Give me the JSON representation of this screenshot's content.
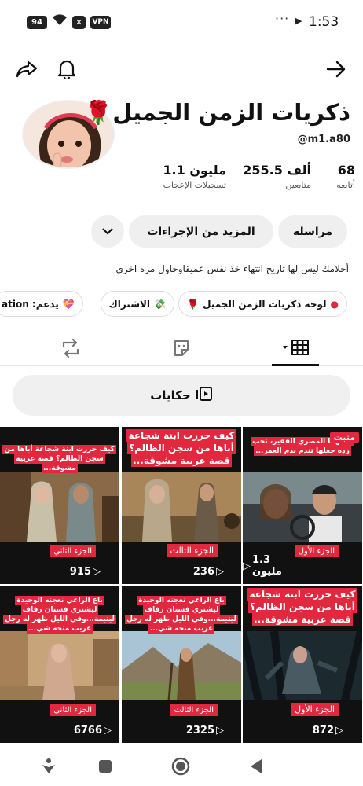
{
  "status_bar": {
    "battery": "94",
    "vpn": "VPN",
    "time": "1:53",
    "dots": "···"
  },
  "profile": {
    "name": "ذكريات الزمن الجميل",
    "name_emoji": "🌹",
    "handle": "@m1.a80",
    "stats": [
      {
        "value": "68",
        "label": "أتابعه"
      },
      {
        "value": "255.5 ألف",
        "label": "متابعين"
      },
      {
        "value": "1.1 مليون",
        "label": "تسجيلات الإعجاب"
      }
    ],
    "bio": "أحلامك ليس لها تاريخ انتهاء خذ نفس عميقاوحاول مره اخرى"
  },
  "actions": {
    "message": "مراسلة",
    "more": "المزيد من الإجراءات"
  },
  "chips": [
    {
      "label": "لوحة ذكريات الزمن الجميل",
      "emoji": "🌹"
    },
    {
      "label": "الاشتراك",
      "emoji": "💸"
    },
    {
      "label": "يدعم: ation",
      "emoji": "💝"
    }
  ],
  "stories_label": "حكايات",
  "icons": {
    "back": "arrow-right-icon",
    "notifications": "bell-icon",
    "share": "share-icon",
    "grid": "grid-icon",
    "sticker": "sticker-icon",
    "repost": "repost-icon"
  },
  "colors": {
    "caption_red": "#e1283f",
    "pill_bg": "#efefef"
  },
  "videos": [
    {
      "caption": "...قهما المصري الفقير، تحب رده جعلها تندم ندم العمر...",
      "part": "الجزء الأول",
      "views": "1.3 مليون",
      "pinned": "مثبت"
    },
    {
      "caption": "كيف حررت ابنة شجاعة أباها من سجن الظالم؟ قصة عربية مشوقة...",
      "part": "الجزء الثالث",
      "views": "236",
      "pinned": ""
    },
    {
      "caption": "كيف حررت ابنة شجاعة أباها من سجن الظالم؟ قصة عربية مشوقة...",
      "part": "الجزء الثاني",
      "views": "915",
      "pinned": ""
    },
    {
      "caption": "كيف حررت ابنة شجاعة أباها من سجن الظالم؟ قصة عربية مشوقة...",
      "part": "الجزء الأول",
      "views": "872",
      "pinned": ""
    },
    {
      "caption": "باع الراعي نعجته الوحيدة ليشتري فستان زفاف ليتيمة...وفي الليل ظهر له رجل غريب منحه شي...",
      "part": "الجزء الثالث",
      "views": "2325",
      "pinned": ""
    },
    {
      "caption": "باع الراعي نعجته الوحيدة ليشتري فستان زفاف ليتيمة...وفي الليل ظهر له رجل غريب منحه شي...",
      "part": "الجزء الثاني",
      "views": "6766",
      "pinned": ""
    }
  ]
}
